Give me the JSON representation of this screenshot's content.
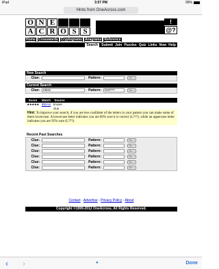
{
  "status": {
    "device": "iPad",
    "time": "3:57 PM",
    "battery": "99%"
  },
  "browser": {
    "url": "Hints from OneAcross.com",
    "done_label": "Done"
  },
  "logo": {
    "row1": [
      "O",
      "N",
      "E",
      ""
    ],
    "row2": [
      "A",
      "C",
      "R",
      "O",
      "S",
      "S"
    ],
    "q1": "!",
    "q2": "@?"
  },
  "nav": {
    "items": [
      "Home",
      "Crosswords",
      "Cryptograms",
      "Anagrams",
      "Reference"
    ]
  },
  "mainbar": {
    "selected": "Search",
    "items": [
      "Submit",
      "Join",
      "Puzzles",
      "Quiz",
      "Links",
      "Now",
      "Help"
    ]
  },
  "new_search": {
    "title": "New Search",
    "clue_label": "Clue:",
    "pattern_label": "Pattern:",
    "clue_value": "",
    "pattern_value": "",
    "go": "Go >"
  },
  "current_search": {
    "title": "Current Search",
    "clue_label": "Clue:",
    "pattern_label": "Pattern:",
    "clue_value": "Ideas",
    "pattern_value": "lost???",
    "go": "Go >"
  },
  "results": {
    "headers": [
      "Score",
      "Match",
      "Source"
    ],
    "rows": [
      {
        "score": "★★★★★",
        "match": "IDEAS",
        "source": "known clue"
      }
    ]
  },
  "hint": {
    "label": "Hint:",
    "text": "To improve your search, if you are less confident of the letters in your pattern you can make some of them lowercase. A lowercase letter indicates you are 60% sure it is correct (L???), while an uppercase letter indicates you are 95% sure (L???)."
  },
  "recent": {
    "title": "Recent Past Searches",
    "clue_label": "Clue:",
    "pattern_label": "Pattern:",
    "go": "Go >",
    "rows": 6
  },
  "footer": {
    "links": [
      "Contact",
      "Advertise",
      "Privacy Policy",
      "About"
    ],
    "separator": "-",
    "copyright": "Copyright ©1999-2012 OneAcross, All Rights Reserved."
  }
}
